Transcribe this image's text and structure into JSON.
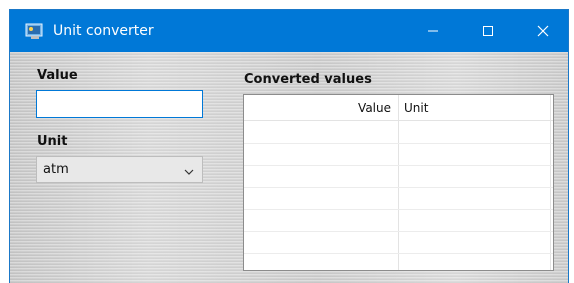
{
  "window": {
    "title": "Unit converter",
    "icons": {
      "app": "app-icon",
      "minimize": "minimize-icon",
      "maximize": "maximize-icon",
      "close": "close-icon"
    }
  },
  "form": {
    "value_label": "Value",
    "value_input": "",
    "unit_label": "Unit",
    "unit_selected": "atm"
  },
  "results": {
    "label": "Converted values",
    "columns": [
      "Value",
      "Unit"
    ]
  },
  "colors": {
    "titlebar": "#0078d7",
    "accent": "#0078d7"
  }
}
